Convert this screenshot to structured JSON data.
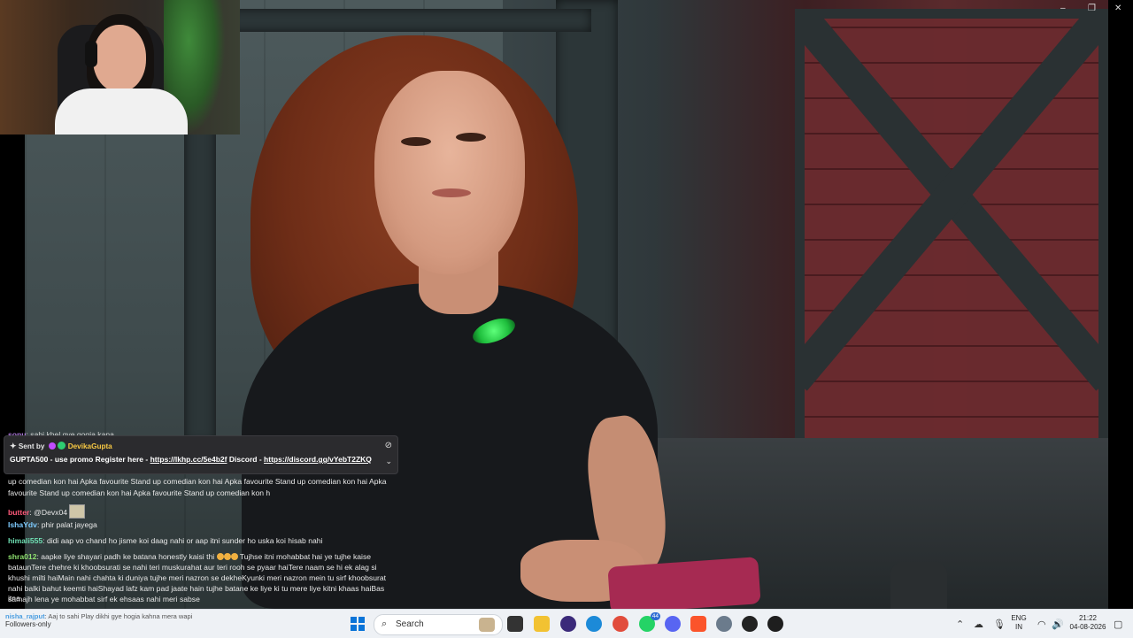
{
  "window": {
    "controls": [
      "–",
      "❐",
      "✕"
    ]
  },
  "pinned": {
    "sent_by": "Sent by",
    "sender": "DevikaGupta",
    "message_prefix": "GUPTA500 - use promo Register here - ",
    "link1": "https://lkhp.cc/5e4b2f",
    "middle": " Discord - ",
    "link2": "https://discord.gg/vYebT2ZKQ"
  },
  "chat": {
    "top_partial": {
      "user": "sonu",
      "text": ": sahi khel gye gogia kana"
    },
    "stand_up_1": "up comedian kon hai Apka favourite Stand up comedian kon hai Apka favourite Stand up comedian kon hai Apka",
    "stand_up_2": "favourite Stand up comedian kon hai Apka favourite Stand up comedian kon h",
    "messages": [
      {
        "user": "butter",
        "color": "#ff5a7a",
        "text": ": @Devx04"
      },
      {
        "user": "IshaYdv",
        "color": "#7ecbff",
        "text": ": phir palat jayega"
      },
      {
        "user": "himali555",
        "color": "#6fe0b4",
        "text": ": didi aap vo chand ho jisme koi daag nahi or aap itni sunder ho uska koi hisab nahi"
      },
      {
        "user": "shra012",
        "color": "#8ee06f",
        "text": ": aapke liye shayari padh ke batana honestly kaisi thi"
      },
      {
        "user": "",
        "color": "#e8e8e8",
        "text": " Tujhse itni mohabbat hai ye tujhe kaise"
      },
      {
        "user": "",
        "color": "#e8e8e8",
        "text": "bataunTere chehre ki khoobsurati se nahi teri muskurahat aur teri rooh se pyaar haiTere naam se hi ek alag si"
      },
      {
        "user": "",
        "color": "#e8e8e8",
        "text": "khushi milti haiMain nahi chahta ki duniya tujhe meri nazron se dekheKyunki meri nazron mein tu sirf khoobsurat"
      },
      {
        "user": "",
        "color": "#e8e8e8",
        "text": "nahi balki bahut keemti haiShayad lafz kam pad jaate hain tujhe batane ke liye ki tu mere liye kitni khaas haiBas itna"
      },
      {
        "user": "",
        "color": "#e8e8e8",
        "text": "samajh lena ye mohabbat sirf ek ehsaas nahi meri sabse"
      }
    ],
    "bottom_partial": {
      "user": "nisha_rajput",
      "text": ": Aaj to sahi Play dikhi gye hogia kahna mera wapi"
    }
  },
  "taskbar": {
    "followers_only": "Followers-only",
    "search_placeholder": "Search",
    "whatsapp_badge": "44",
    "lang_top": "ENG",
    "lang_bottom": "IN",
    "time": "21:22",
    "date": "04-08-2026"
  },
  "colors": {
    "accent": "#0a74d8",
    "taskbar_bg": "#eef1f5"
  }
}
